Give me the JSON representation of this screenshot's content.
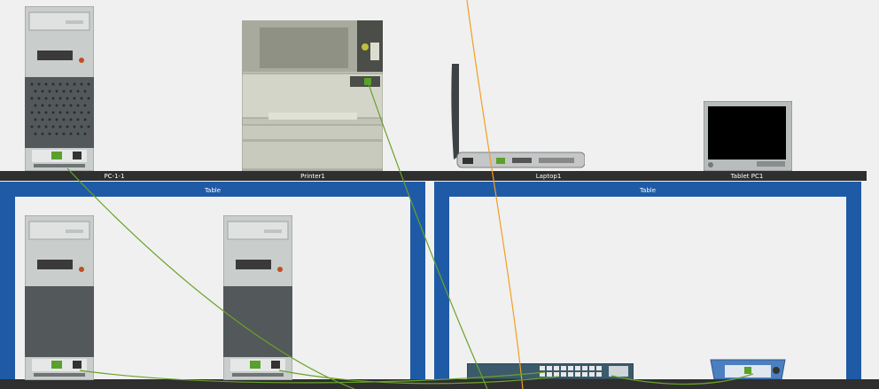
{
  "top_shelf": {
    "labels": [
      "PC-1-1",
      "Printer1",
      "Laptop1",
      "Tablet PC1"
    ]
  },
  "tables": [
    {
      "title": "Table"
    },
    {
      "title": "Table"
    }
  ],
  "devices": [
    {
      "name": "pc",
      "icon": "desktop-tower-icon"
    },
    {
      "name": "printer",
      "icon": "printer-icon"
    },
    {
      "name": "laptop",
      "icon": "laptop-icon"
    },
    {
      "name": "tablet",
      "icon": "tablet-icon"
    },
    {
      "name": "switch",
      "icon": "network-switch-icon"
    },
    {
      "name": "router",
      "icon": "wireless-router-icon"
    }
  ],
  "colors": {
    "table_blue": "#1f5aa6",
    "shelf": "#2f2f2f",
    "copper_cable": "#6aa229",
    "fiber_cable": "#f0a020"
  }
}
